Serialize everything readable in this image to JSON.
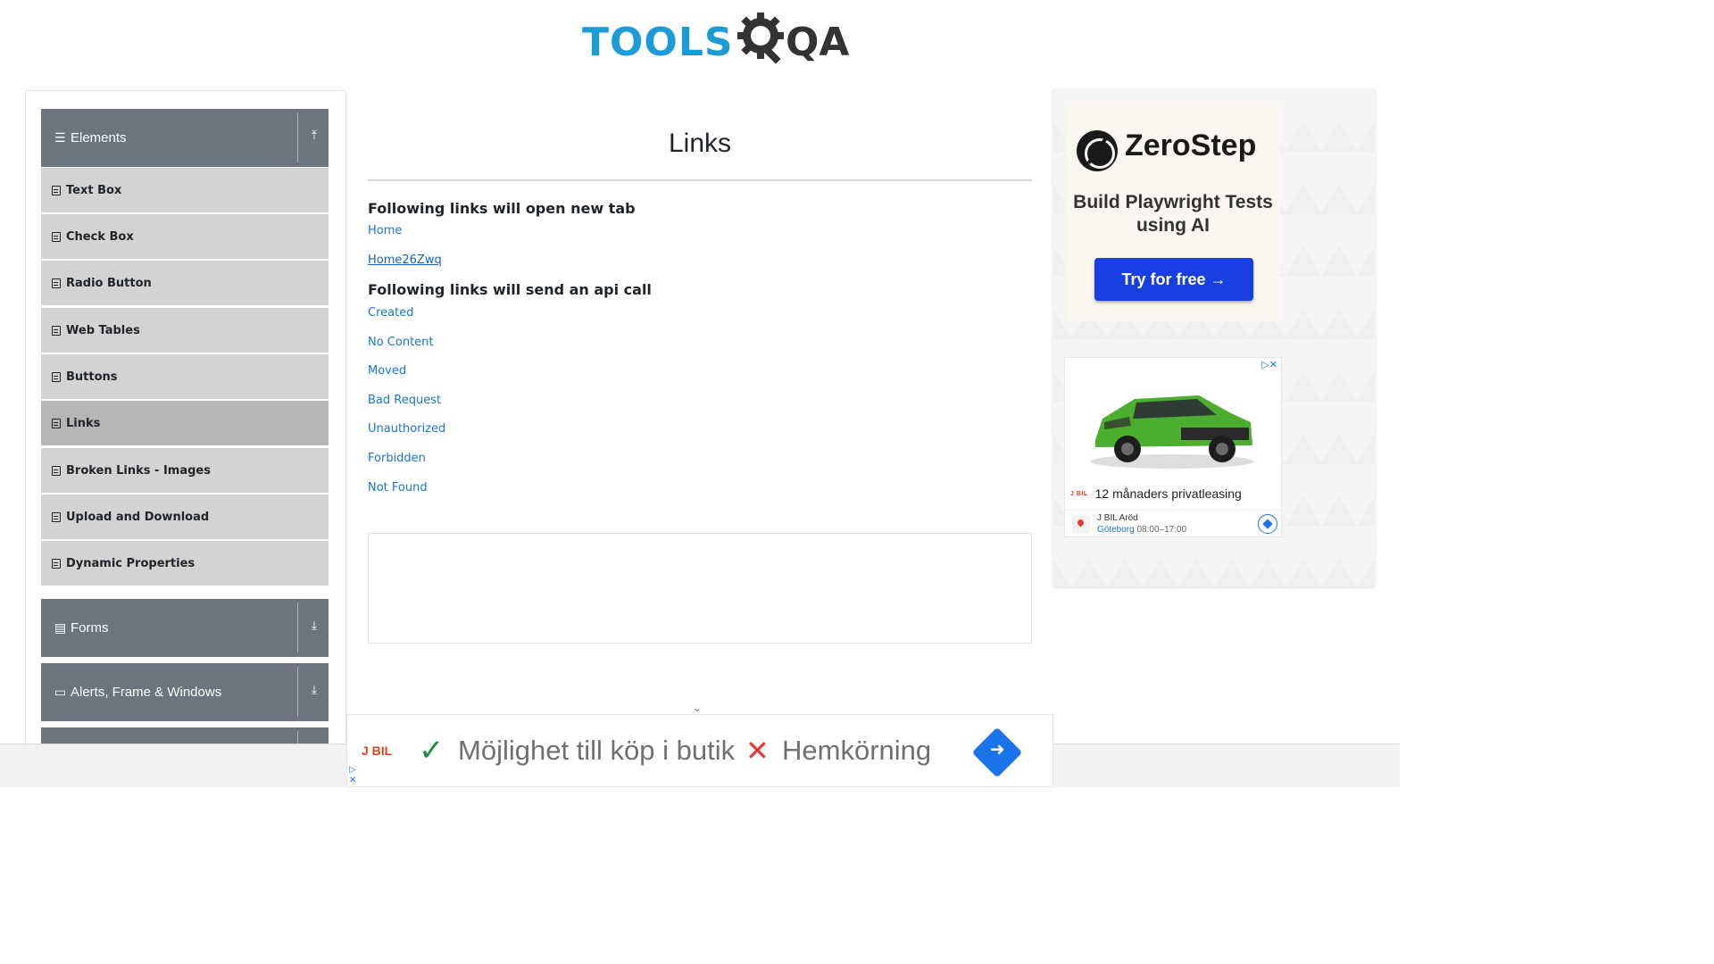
{
  "logo": {
    "text": "TOOLS",
    "accent": "QA",
    "brand_color": "#1d9bd6"
  },
  "sidebar": {
    "groups": [
      {
        "label": "Elements",
        "icon": "hamburger-icon",
        "arrow": "collapse-up-icon"
      },
      {
        "label": "Forms",
        "icon": "form-icon",
        "arrow": "expand-down-icon"
      },
      {
        "label": "Alerts, Frame & Windows",
        "icon": "window-icon",
        "arrow": "expand-down-icon"
      }
    ],
    "items": [
      {
        "label": "Text Box"
      },
      {
        "label": "Check Box"
      },
      {
        "label": "Radio Button"
      },
      {
        "label": "Web Tables"
      },
      {
        "label": "Buttons"
      },
      {
        "label": "Links",
        "active": true
      },
      {
        "label": "Broken Links - Images"
      },
      {
        "label": "Upload and Download"
      },
      {
        "label": "Dynamic Properties"
      }
    ]
  },
  "main": {
    "title": "Links",
    "section1": "Following links will open new tab",
    "new_tab_links": [
      "Home",
      "Home26Zwq"
    ],
    "section2": "Following links will send an api call",
    "api_links": [
      "Created",
      "No Content",
      "Moved",
      "Bad Request",
      "Unauthorized",
      "Forbidden",
      "Not Found"
    ],
    "link_color": "#1976d2"
  },
  "right_ad": {
    "brand": "ZeroStep",
    "tagline": "Build Playwright Tests using AI",
    "cta": "Try for free →",
    "car_title": "12 månaders privatleasing",
    "car_brand": "J BIL",
    "dealer": "J BIL Aröd",
    "city": "Göteborg",
    "hours": "08:00–17:00"
  },
  "bottom_ad": {
    "brand": "J BIL",
    "feature_yes": "Möjlighet till köp i butik",
    "feature_no": "Hemkörning"
  }
}
